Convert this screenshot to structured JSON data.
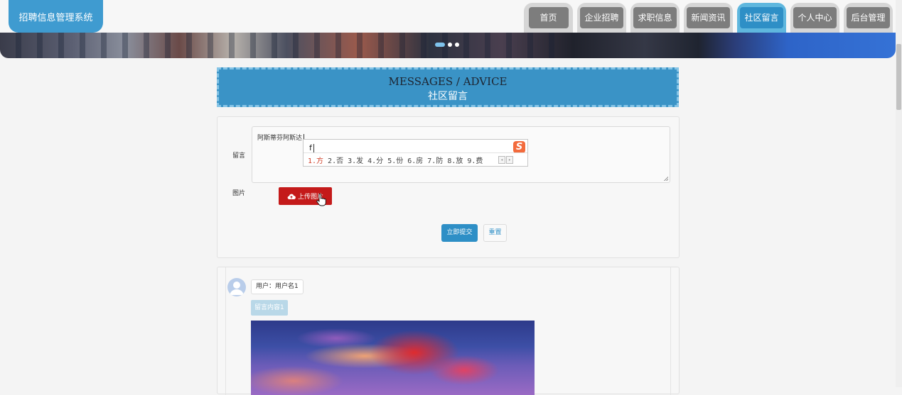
{
  "app": {
    "title": "招聘信息管理系统"
  },
  "nav": {
    "items": [
      {
        "label": "首页"
      },
      {
        "label": "企业招聘"
      },
      {
        "label": "求职信息"
      },
      {
        "label": "新闻资讯"
      },
      {
        "label": "社区留言",
        "active": true
      },
      {
        "label": "个人中心"
      },
      {
        "label": "后台管理"
      }
    ]
  },
  "banner": {
    "dots": 3,
    "active_dot": 1
  },
  "page_title": {
    "en": "MESSAGES / ADVICE",
    "cn": "社区留言"
  },
  "form": {
    "message_label": "留言",
    "message_value": "阿斯蒂芬阿斯达",
    "image_label": "图片",
    "upload_label": "上传图片",
    "submit_label": "立即提交",
    "reset_label": "重置"
  },
  "ime": {
    "input": "f",
    "logo": "S",
    "candidates": [
      "1.方",
      "2.否",
      "3.发",
      "4.分",
      "5.份",
      "6.房",
      "7.防",
      "8.放",
      "9.费"
    ]
  },
  "messages": [
    {
      "user_label": "用户：用户名1",
      "content": "留言内容1"
    }
  ],
  "colors": {
    "accent": "#2e8fc6",
    "upload": "#c41a1a",
    "nav_inactive": "#7d7d7d"
  }
}
